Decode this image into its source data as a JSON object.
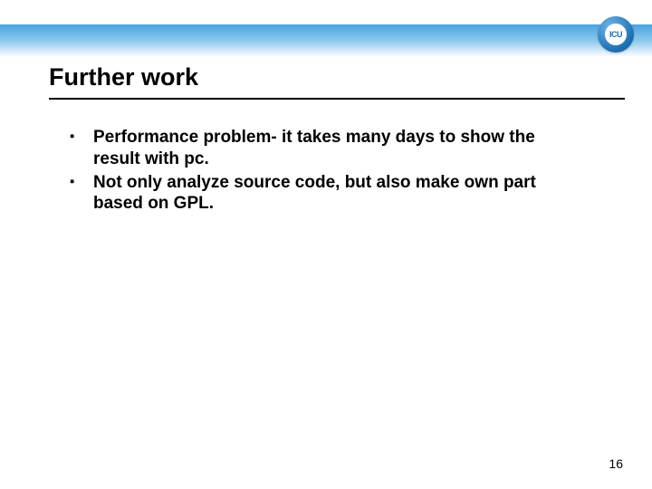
{
  "logo": {
    "text": "ICU"
  },
  "title": "Further work",
  "bullets": [
    "Performance problem- it takes many days to show the result with pc.",
    "Not only analyze source code, but also make own part based on GPL."
  ],
  "page_number": "16"
}
